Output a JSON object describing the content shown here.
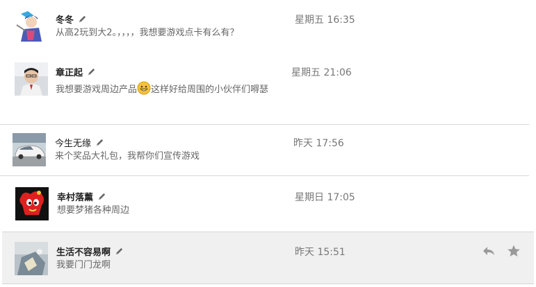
{
  "conversations": [
    {
      "name": "冬冬",
      "time": "星期五 16:35",
      "message": "从高2玩到大2。，，，，我想要游戏点卡有么有？"
    },
    {
      "name": "章正起",
      "time": "星期五 21:06",
      "message_before": "我想要游戏周边产品",
      "message_after": "这样好给周围的小伙伴们嘚瑟",
      "emoji": "grinning-emoji"
    },
    {
      "name": "今生无缘",
      "time": "昨天 17:56",
      "message": "来个奖品大礼包，我帮你们宣传游戏"
    },
    {
      "name": "幸村落薰",
      "time": "星期日 17:05",
      "message": "想要梦猪各种周边"
    },
    {
      "name": "生活不容易啊",
      "time": "昨天 15:51",
      "message": "我要门门龙啊"
    }
  ],
  "icons": {
    "edit": "pencil-icon",
    "reply": "reply-icon",
    "star": "star-icon"
  },
  "colors": {
    "selected_row_bg": "#f0f0f0",
    "time_text": "#777777",
    "message_text": "#666666",
    "icon_gray": "#9a9a9a"
  }
}
